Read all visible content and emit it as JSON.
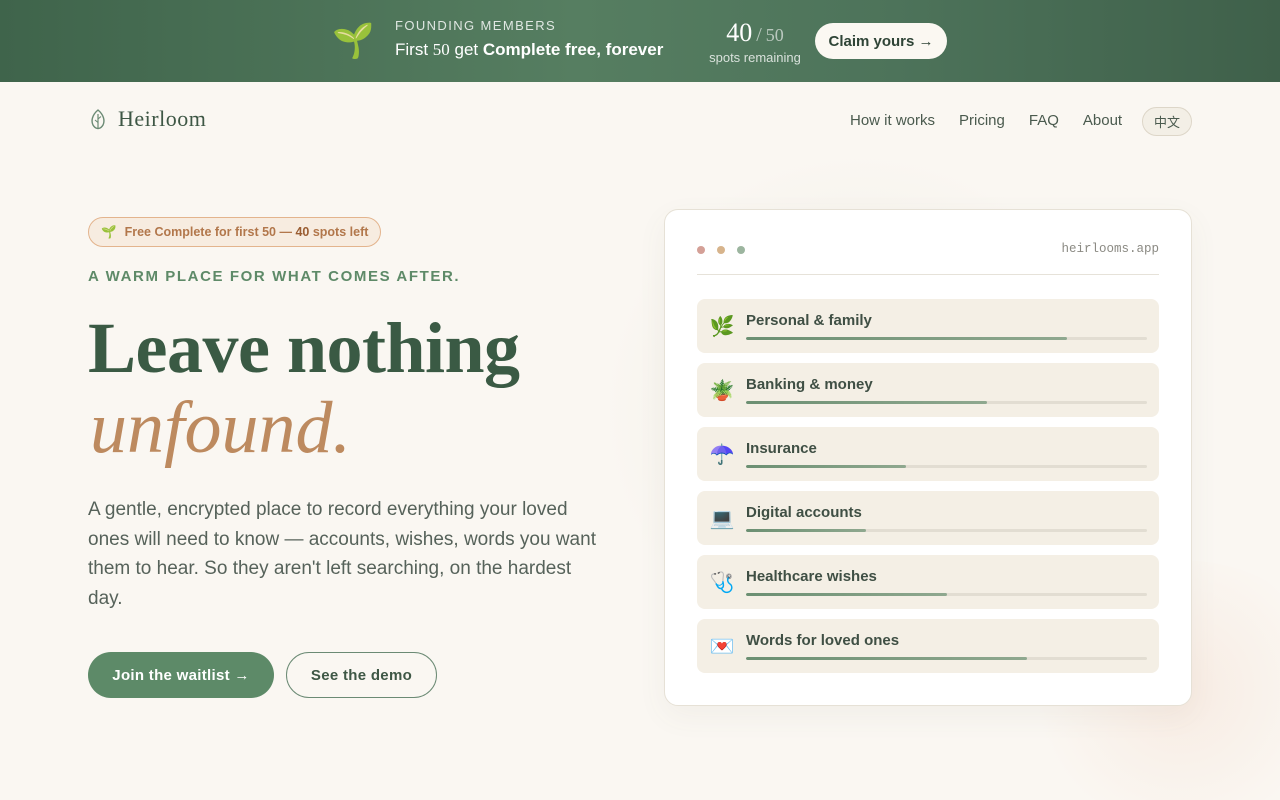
{
  "banner": {
    "kicker": "FOUNDING MEMBERS",
    "line_prefix": "First ",
    "line_num": "50",
    "line_mid": " get ",
    "line_bold": "Complete free, forever",
    "spots_count": "40",
    "spots_total": "50",
    "spots_label": "spots remaining",
    "claim_label": "Claim yours →",
    "sprout_icon": "sprout-icon"
  },
  "nav": {
    "logo_text": "Heirloom",
    "links": [
      "How it works",
      "Pricing",
      "FAQ",
      "About"
    ],
    "lang_label": "中文"
  },
  "hero": {
    "pill_prefix": "Free Complete for first 50 — ",
    "pill_count": "40",
    "pill_suffix": " spots left",
    "eyebrow": "A WARM PLACE FOR WHAT COMES AFTER.",
    "headline_1": "Leave nothing",
    "headline_2": "unfound.",
    "lede": "A gentle, encrypted place to record everything your loved ones will need to know — accounts, wishes, words you want them to hear. So they aren't left searching, on the hardest day.",
    "primary_cta": "Join the waitlist →",
    "secondary_cta": "See the demo"
  },
  "preview": {
    "url": "heirlooms.app",
    "dot_colors": [
      "#d4a097",
      "#d7b48c",
      "#9cb59f"
    ],
    "categories": [
      {
        "label": "Personal & family",
        "icon": "🌿",
        "icon_name": "herb-icon",
        "progress": 0.8
      },
      {
        "label": "Banking & money",
        "icon": "🪴",
        "icon_name": "potted-plant-icon",
        "progress": 0.6
      },
      {
        "label": "Insurance",
        "icon": "☂️",
        "icon_name": "umbrella-icon",
        "progress": 0.4
      },
      {
        "label": "Digital accounts",
        "icon": "💻",
        "icon_name": "laptop-icon",
        "progress": 0.3
      },
      {
        "label": "Healthcare wishes",
        "icon": "🩺",
        "icon_name": "stethoscope-icon",
        "progress": 0.5
      },
      {
        "label": "Words for loved ones",
        "icon": "💌",
        "icon_name": "love-letter-icon",
        "progress": 0.7
      }
    ]
  },
  "colors": {
    "brand_green": "#5d8a68",
    "accent_tan": "#bd8a5f",
    "background": "#faf7f2"
  }
}
